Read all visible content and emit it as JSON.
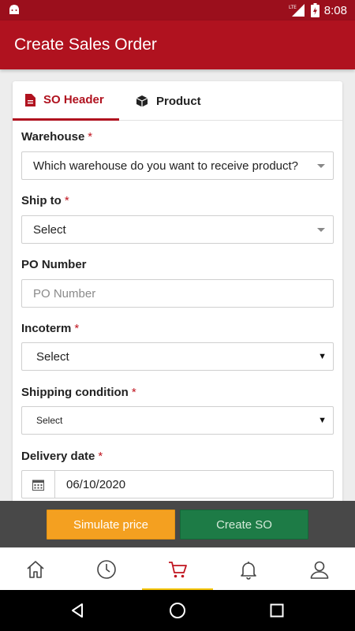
{
  "status_bar": {
    "time": "8:08",
    "network": "LTE"
  },
  "app_bar": {
    "title": "Create Sales Order"
  },
  "tabs": [
    {
      "label": "SO Header",
      "icon": "document-icon",
      "active": true
    },
    {
      "label": "Product",
      "icon": "box-icon",
      "active": false
    }
  ],
  "form": {
    "warehouse": {
      "label": "Warehouse",
      "required": "*",
      "value": "Which warehouse do you want to receive product?"
    },
    "ship_to": {
      "label": "Ship to",
      "required": "*",
      "value": "Select"
    },
    "po_number": {
      "label": "PO Number",
      "placeholder": "PO Number",
      "value": ""
    },
    "incoterm": {
      "label": "Incoterm",
      "required": "*",
      "value": "Select"
    },
    "shipping_condition": {
      "label": "Shipping condition",
      "required": "*",
      "value": "Select"
    },
    "delivery_date": {
      "label": "Delivery date",
      "required": "*",
      "value": "06/10/2020",
      "icon": "calendar-icon"
    }
  },
  "actions": {
    "simulate_label": "Simulate price",
    "create_label": "Create SO"
  },
  "bottom_nav": [
    {
      "name": "home",
      "icon": "home-icon"
    },
    {
      "name": "history",
      "icon": "clock-icon"
    },
    {
      "name": "cart",
      "icon": "cart-icon",
      "active": true
    },
    {
      "name": "notifications",
      "icon": "bell-icon"
    },
    {
      "name": "profile",
      "icon": "user-icon"
    }
  ],
  "colors": {
    "primary": "#b0121f",
    "status_bar": "#9b0f1c",
    "simulate": "#f4a020",
    "create": "#1d7b46",
    "nav_active": "#f3c300"
  }
}
